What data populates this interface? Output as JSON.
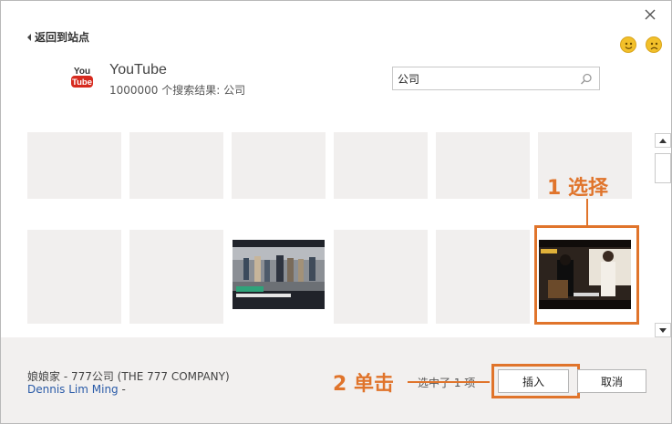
{
  "dialog": {
    "close_icon": "close-icon",
    "back_label": "返回到站点",
    "feedback_icons": [
      "smiley-happy-icon",
      "smiley-sad-icon"
    ]
  },
  "provider": {
    "logo_text_top": "You",
    "logo_text_bottom": "Tube",
    "name": "YouTube",
    "result_count": "1000000 个搜索结果: 公司"
  },
  "search": {
    "value": "公司",
    "placeholder": ""
  },
  "results": {
    "row1_count": 6,
    "row2_count": 6,
    "thumbnail_tiles": [
      3,
      6
    ]
  },
  "annotations": {
    "step1": "1 选择",
    "step2": "2 单击",
    "color": "#e0742b"
  },
  "footer": {
    "video_title": "娘娘家 - 777公司 (THE 777 COMPANY)",
    "author": "Dennis Lim Ming",
    "author_suffix": " -",
    "selected_count": "选中了 1 项",
    "insert_label": "插入",
    "cancel_label": "取消"
  }
}
